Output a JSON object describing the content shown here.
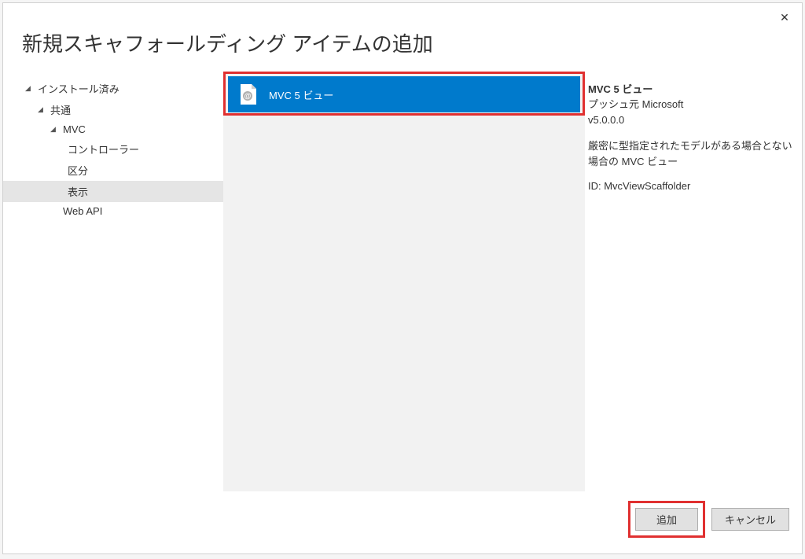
{
  "dialog": {
    "title": "新規スキャフォールディング アイテムの追加",
    "close_label": "✕"
  },
  "tree": {
    "installed": "インストール済み",
    "common": "共通",
    "mvc": "MVC",
    "controllers": "コントローラー",
    "area": "区分",
    "view": "表示",
    "webapi": "Web API"
  },
  "center": {
    "items": [
      {
        "label": "MVC 5 ビュー",
        "icon": "razor-view-icon"
      }
    ]
  },
  "details": {
    "title": "MVC 5 ビュー",
    "publisher_label": "プッシュ元 Microsoft",
    "version": "v5.0.0.0",
    "description": "厳密に型指定されたモデルがある場合とない場合の MVC ビュー",
    "id": "ID: MvcViewScaffolder"
  },
  "footer": {
    "add": "追加",
    "cancel": "キャンセル"
  }
}
